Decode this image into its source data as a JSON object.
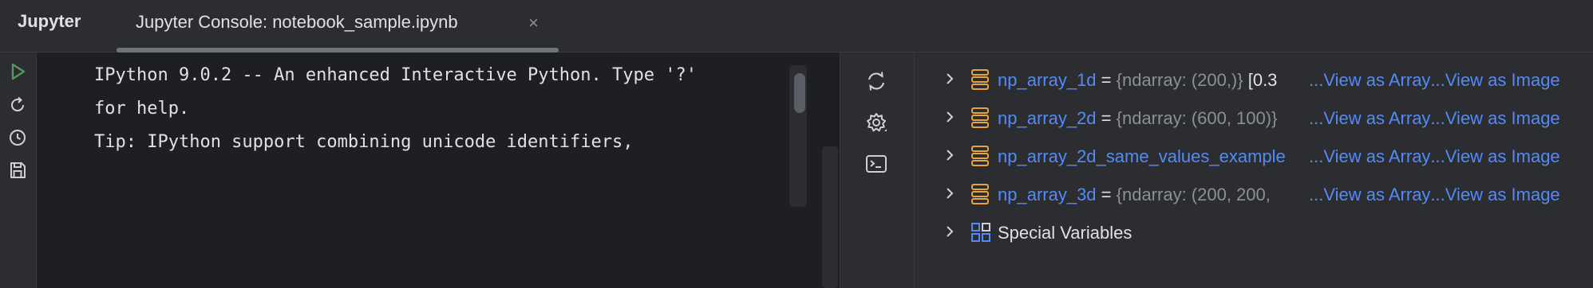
{
  "app": {
    "title": "Jupyter"
  },
  "tab": {
    "label": "Jupyter Console: notebook_sample.ipynb",
    "close": "×"
  },
  "left_toolbar": {
    "items": [
      {
        "icon": "run-icon",
        "color": "#57965c"
      },
      {
        "icon": "restart-icon"
      },
      {
        "icon": "history-icon"
      },
      {
        "icon": "save-icon"
      }
    ]
  },
  "console": {
    "lines": [
      "IPython 9.0.2 -- An enhanced Interactive Python. Type '?'",
      "for help.",
      "Tip: IPython support combining unicode identifiers,"
    ]
  },
  "mid_toolbar": {
    "items": [
      {
        "icon": "sync-icon"
      },
      {
        "icon": "settings-icon"
      },
      {
        "icon": "terminal-icon"
      }
    ]
  },
  "variables": {
    "items": [
      {
        "name": "np_array_1d",
        "eq": " = ",
        "type": "{ndarray: (200,)}",
        "value": " [0.3",
        "view_array": "...View as Array",
        "view_image": "...View as Image"
      },
      {
        "name": "np_array_2d",
        "eq": " = ",
        "type": "{ndarray: (600, 100)}",
        "value": "",
        "view_array": "...View as Array",
        "view_image": "...View as Image"
      },
      {
        "name": "np_array_2d_same_values_example",
        "eq": "",
        "type": "",
        "value": "",
        "view_array": "...View as Array",
        "view_image": "...View as Image"
      },
      {
        "name": "np_array_3d",
        "eq": " = ",
        "type": "{ndarray: (200, 200,",
        "value": "",
        "view_array": "...View as Array",
        "view_image": "...View as Image"
      }
    ],
    "special": {
      "label": "Special Variables"
    }
  },
  "colors": {
    "background": "#1e1f22",
    "panel": "#2b2d30",
    "link": "#548af7",
    "array_icon": "#e8a33d",
    "run": "#57965c"
  }
}
